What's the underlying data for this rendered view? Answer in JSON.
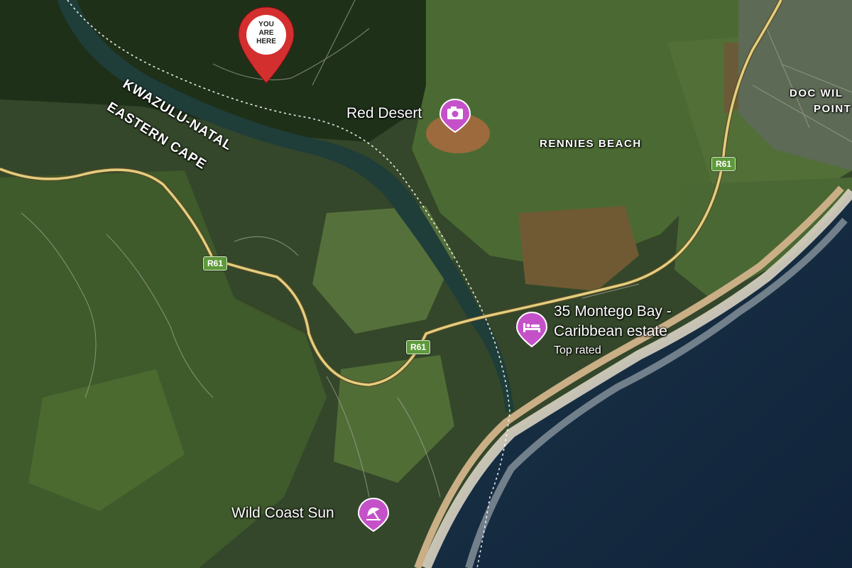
{
  "marker": {
    "line1": "YOU",
    "line2": "ARE",
    "line3": "HERE",
    "icon": "map-pin-icon",
    "color": "#d32f2f"
  },
  "provinces": {
    "north": "KWAZULU-NATAL",
    "south": "EASTERN CAPE"
  },
  "areas": {
    "rennies": "RENNIES BEACH",
    "doc_line1": "DOC WIL",
    "doc_line2": "POINT"
  },
  "roads": {
    "label": "R61"
  },
  "pois": {
    "red_desert": {
      "label": "Red Desert",
      "icon": "camera-icon"
    },
    "montego": {
      "line1": "35 Montego Bay -",
      "line2": "Caribbean estate",
      "rating": "Top rated",
      "icon": "bed-icon"
    },
    "wild_coast": {
      "label": "Wild Coast Sun",
      "icon": "umbrella-icon"
    }
  },
  "colors": {
    "poi_pin": "#c551c9",
    "road": "#e2cf7e",
    "shield": "#5e9a3c",
    "water": "#1d3d3c",
    "ocean": "#152a3d"
  }
}
